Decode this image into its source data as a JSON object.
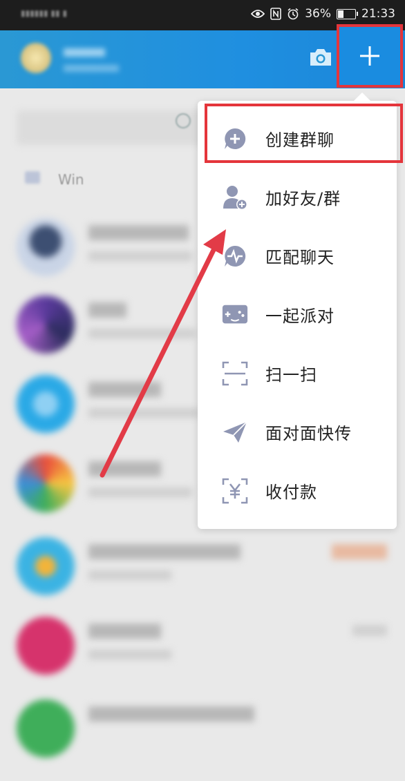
{
  "status_bar": {
    "battery": "36%",
    "time": "21:33",
    "battery_level": 0.36
  },
  "background": {
    "notice_text": "Win"
  },
  "menu": {
    "items": [
      {
        "label": "创建群聊",
        "icon": "add-chat-icon"
      },
      {
        "label": "加好友/群",
        "icon": "add-friend-icon"
      },
      {
        "label": "匹配聊天",
        "icon": "match-chat-icon"
      },
      {
        "label": "一起派对",
        "icon": "party-game-icon"
      },
      {
        "label": "扫一扫",
        "icon": "scan-icon"
      },
      {
        "label": "面对面快传",
        "icon": "send-plane-icon"
      },
      {
        "label": "收付款",
        "icon": "payment-icon"
      }
    ]
  },
  "colors": {
    "header": "#1f8fe0",
    "highlight": "#e4353b",
    "icon": "#8f96b3"
  }
}
